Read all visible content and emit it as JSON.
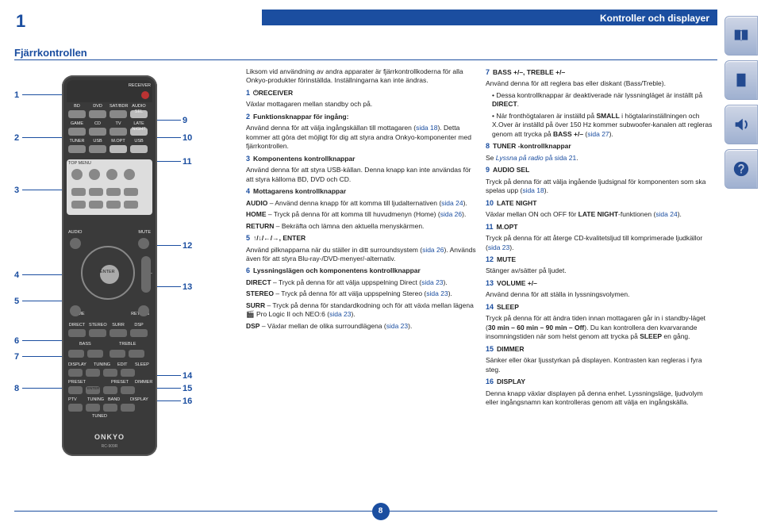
{
  "header": {
    "page_indicator": "1",
    "title": "Kontroller och displayer"
  },
  "section_title": "Fjärrkontrollen",
  "page_number": "8",
  "remote": {
    "receiver_label": "RECEIVER",
    "row1": [
      "BD",
      "DVD",
      "SAT/BDR",
      "AUDIO SEL"
    ],
    "row2": [
      "GAME",
      "CD",
      "TV",
      "LATE NIGHT"
    ],
    "row3": [
      "TUNER",
      "USB",
      "M.OPT",
      "USB"
    ],
    "top_menu": "TOP MENU",
    "audio": "AUDIO",
    "mute": "MUTE",
    "enter": "ENTER",
    "vol": "VOL",
    "home": "HOME",
    "ret": "RETURN",
    "row6": [
      "DIRECT",
      "STEREO",
      "SURR",
      "DSP"
    ],
    "bass": "BASS",
    "treble": "TREBLE",
    "display": "DISPLAY",
    "tuning": "TUNING",
    "edit": "EDIT",
    "sleep": "SLEEP",
    "preset": "PRESET",
    "dimmer": "DIMMER",
    "ptv": "PTV",
    "band": "BAND",
    "display2": "DISPLAY",
    "tuned": "TUNED",
    "logo": "ONKYO",
    "model": "RC-909R"
  },
  "callouts_left": [
    "1",
    "2",
    "3",
    "4",
    "5",
    "6",
    "7",
    "8"
  ],
  "callouts_right": [
    "9",
    "10",
    "11",
    "12",
    "13",
    "14",
    "15",
    "16"
  ],
  "colA": {
    "p1": "Liksom vid användning av andra apparater är fjärrkontrollkoderna för alla Onkyo-produkter förinställda. Inställningarna kan inte ändras.",
    "i1_lead": "1",
    "i1_label": "⏻RECEIVER",
    "i1_body": "Växlar mottagaren mellan standby och på.",
    "i2_lead": "2",
    "i2_label": "Funktionsknappar för ingång:",
    "i2_body_a": "Använd denna för att välja ingångskällan till mottagaren (",
    "i2_link": "sida 18",
    "i2_body_b": "). Detta kommer att göra det möjligt för dig att styra andra Onkyo-komponenter med fjärrkontrollen.",
    "i3_lead": "3",
    "i3_label": "Komponentens kontrollknappar",
    "i3_body": "Använd denna för att styra USB-källan. Denna knapp kan inte användas för att styra källorna BD, DVD och CD.",
    "i4_lead": "4",
    "i4_label": "Mottagarens kontrollknappar",
    "i4a_t": "AUDIO",
    "i4a_b": " – Använd denna knapp för att komma till ljudalternativen (",
    "i4a_link": "sida 24",
    "i4a_c": ").",
    "i4b_t": "HOME",
    "i4b_b": " – Tryck på denna för att komma till huvudmenyn (Home) (",
    "i4b_link": "sida 26",
    "i4b_c": ").",
    "i4c_t": "RETURN",
    "i4c_b": " – Bekräfta och lämna den aktuella menyskärmen.",
    "i5_lead": "5",
    "i5_label": "↑/↓/←/→, ENTER",
    "i5_body_a": "Använd pilknapparna när du ställer in ditt surroundsystem (",
    "i5_link": "sida 26",
    "i5_body_b": "). Används även för att styra Blu-ray-/DVD-menyer/-alternativ.",
    "i6_lead": "6",
    "i6_label": "Lyssningslägen och komponentens kontrollknappar",
    "i6a_t": "DIRECT",
    "i6a_b": " – Tryck på denna för att välja uppspelning Direct (",
    "i6a_link": "sida 23",
    "i6a_c": ").",
    "i6b_t": "STEREO",
    "i6b_b": " – Tryck på denna för att välja uppspelning Stereo (",
    "i6b_link": "sida 23",
    "i6b_c": ").",
    "i6c_t": "SURR",
    "i6c_b": " – Tryck på denna för standardkodning och för att växla mellan lägena 🎬 Pro Logic II och NEO:6 (",
    "i6c_link": "sida 23",
    "i6c_c": ").",
    "i6d_t": "DSP",
    "i6d_b": " – Växlar mellan de olika surroundlägena (",
    "i6d_link": "sida 23",
    "i6d_c": ")."
  },
  "colB": {
    "i7_lead": "7",
    "i7_label": "BASS +/–, TREBLE +/–",
    "i7_body": "Använd denna för att reglera bas eller diskant (Bass/Treble).",
    "i7_bul1_a": "Dessa kontrollknappar är deaktiverade när lyssningläget är inställt på ",
    "i7_bul1_b": "DIRECT",
    "i7_bul1_c": ".",
    "i7_bul2_a": "När fronthögtalaren är inställd på ",
    "i7_bul2_b": "SMALL",
    "i7_bul2_c": " i högtalarinställningen och X.Over är inställd på över 150 Hz kommer subwoofer-kanalen att regleras genom att trycka på ",
    "i7_bul2_d": "BASS +/–",
    "i7_bul2_e": " (",
    "i7_bul2_link": "sida 27",
    "i7_bul2_f": ").",
    "i8_lead": "8",
    "i8_label": "TUNER -kontrollknappar",
    "i8_body_a": "Se ",
    "i8_link_it": "Lyssna på radio",
    "i8_body_b": " på sida 21",
    "i8_body_c": ".",
    "i9_lead": "9",
    "i9_label": "AUDIO SEL",
    "i9_body_a": "Tryck på denna för att välja ingående ljudsignal för komponenten som ska spelas upp (",
    "i9_link": "sida 18",
    "i9_body_b": ").",
    "i10_lead": "10",
    "i10_label": "LATE NIGHT",
    "i10_body_a": "Växlar mellan ON och OFF för ",
    "i10_bold": "LATE NIGHT",
    "i10_body_b": "-funktionen (",
    "i10_link": "sida 24",
    "i10_body_c": ").",
    "i11_lead": "11",
    "i11_label": "M.OPT",
    "i11_body_a": "Tryck på denna för att återge CD-kvalitetsljud till komprimerade ljudkällor (",
    "i11_link": "sida 23",
    "i11_body_b": ").",
    "i12_lead": "12",
    "i12_label": "MUTE",
    "i12_body": "Stänger av/sätter på ljudet.",
    "i13_lead": "13",
    "i13_label": "VOLUME +/–",
    "i13_body": "Använd denna för att ställa in lyssningsvolymen.",
    "i14_lead": "14",
    "i14_label": "SLEEP",
    "i14_body_a": "Tryck på denna för att ändra tiden innan mottagaren går in i standby-läget (",
    "i14_bold": "30 min – 60 min – 90 min – Off",
    "i14_body_b": "). Du kan kontrollera den kvarvarande insomningstiden när som helst genom att trycka på ",
    "i14_bold2": "SLEEP",
    "i14_body_c": " en gång.",
    "i15_lead": "15",
    "i15_label": "DIMMER",
    "i15_body": "Sänker eller ökar ljusstyrkan på displayen. Kontrasten kan regleras i fyra steg.",
    "i16_lead": "16",
    "i16_label": "DISPLAY",
    "i16_body": "Denna knapp växlar displayen på denna enhet. Lyssningsläge, ljudvolym eller ingångsnamn kan kontrolleras genom att välja en ingångskälla."
  }
}
